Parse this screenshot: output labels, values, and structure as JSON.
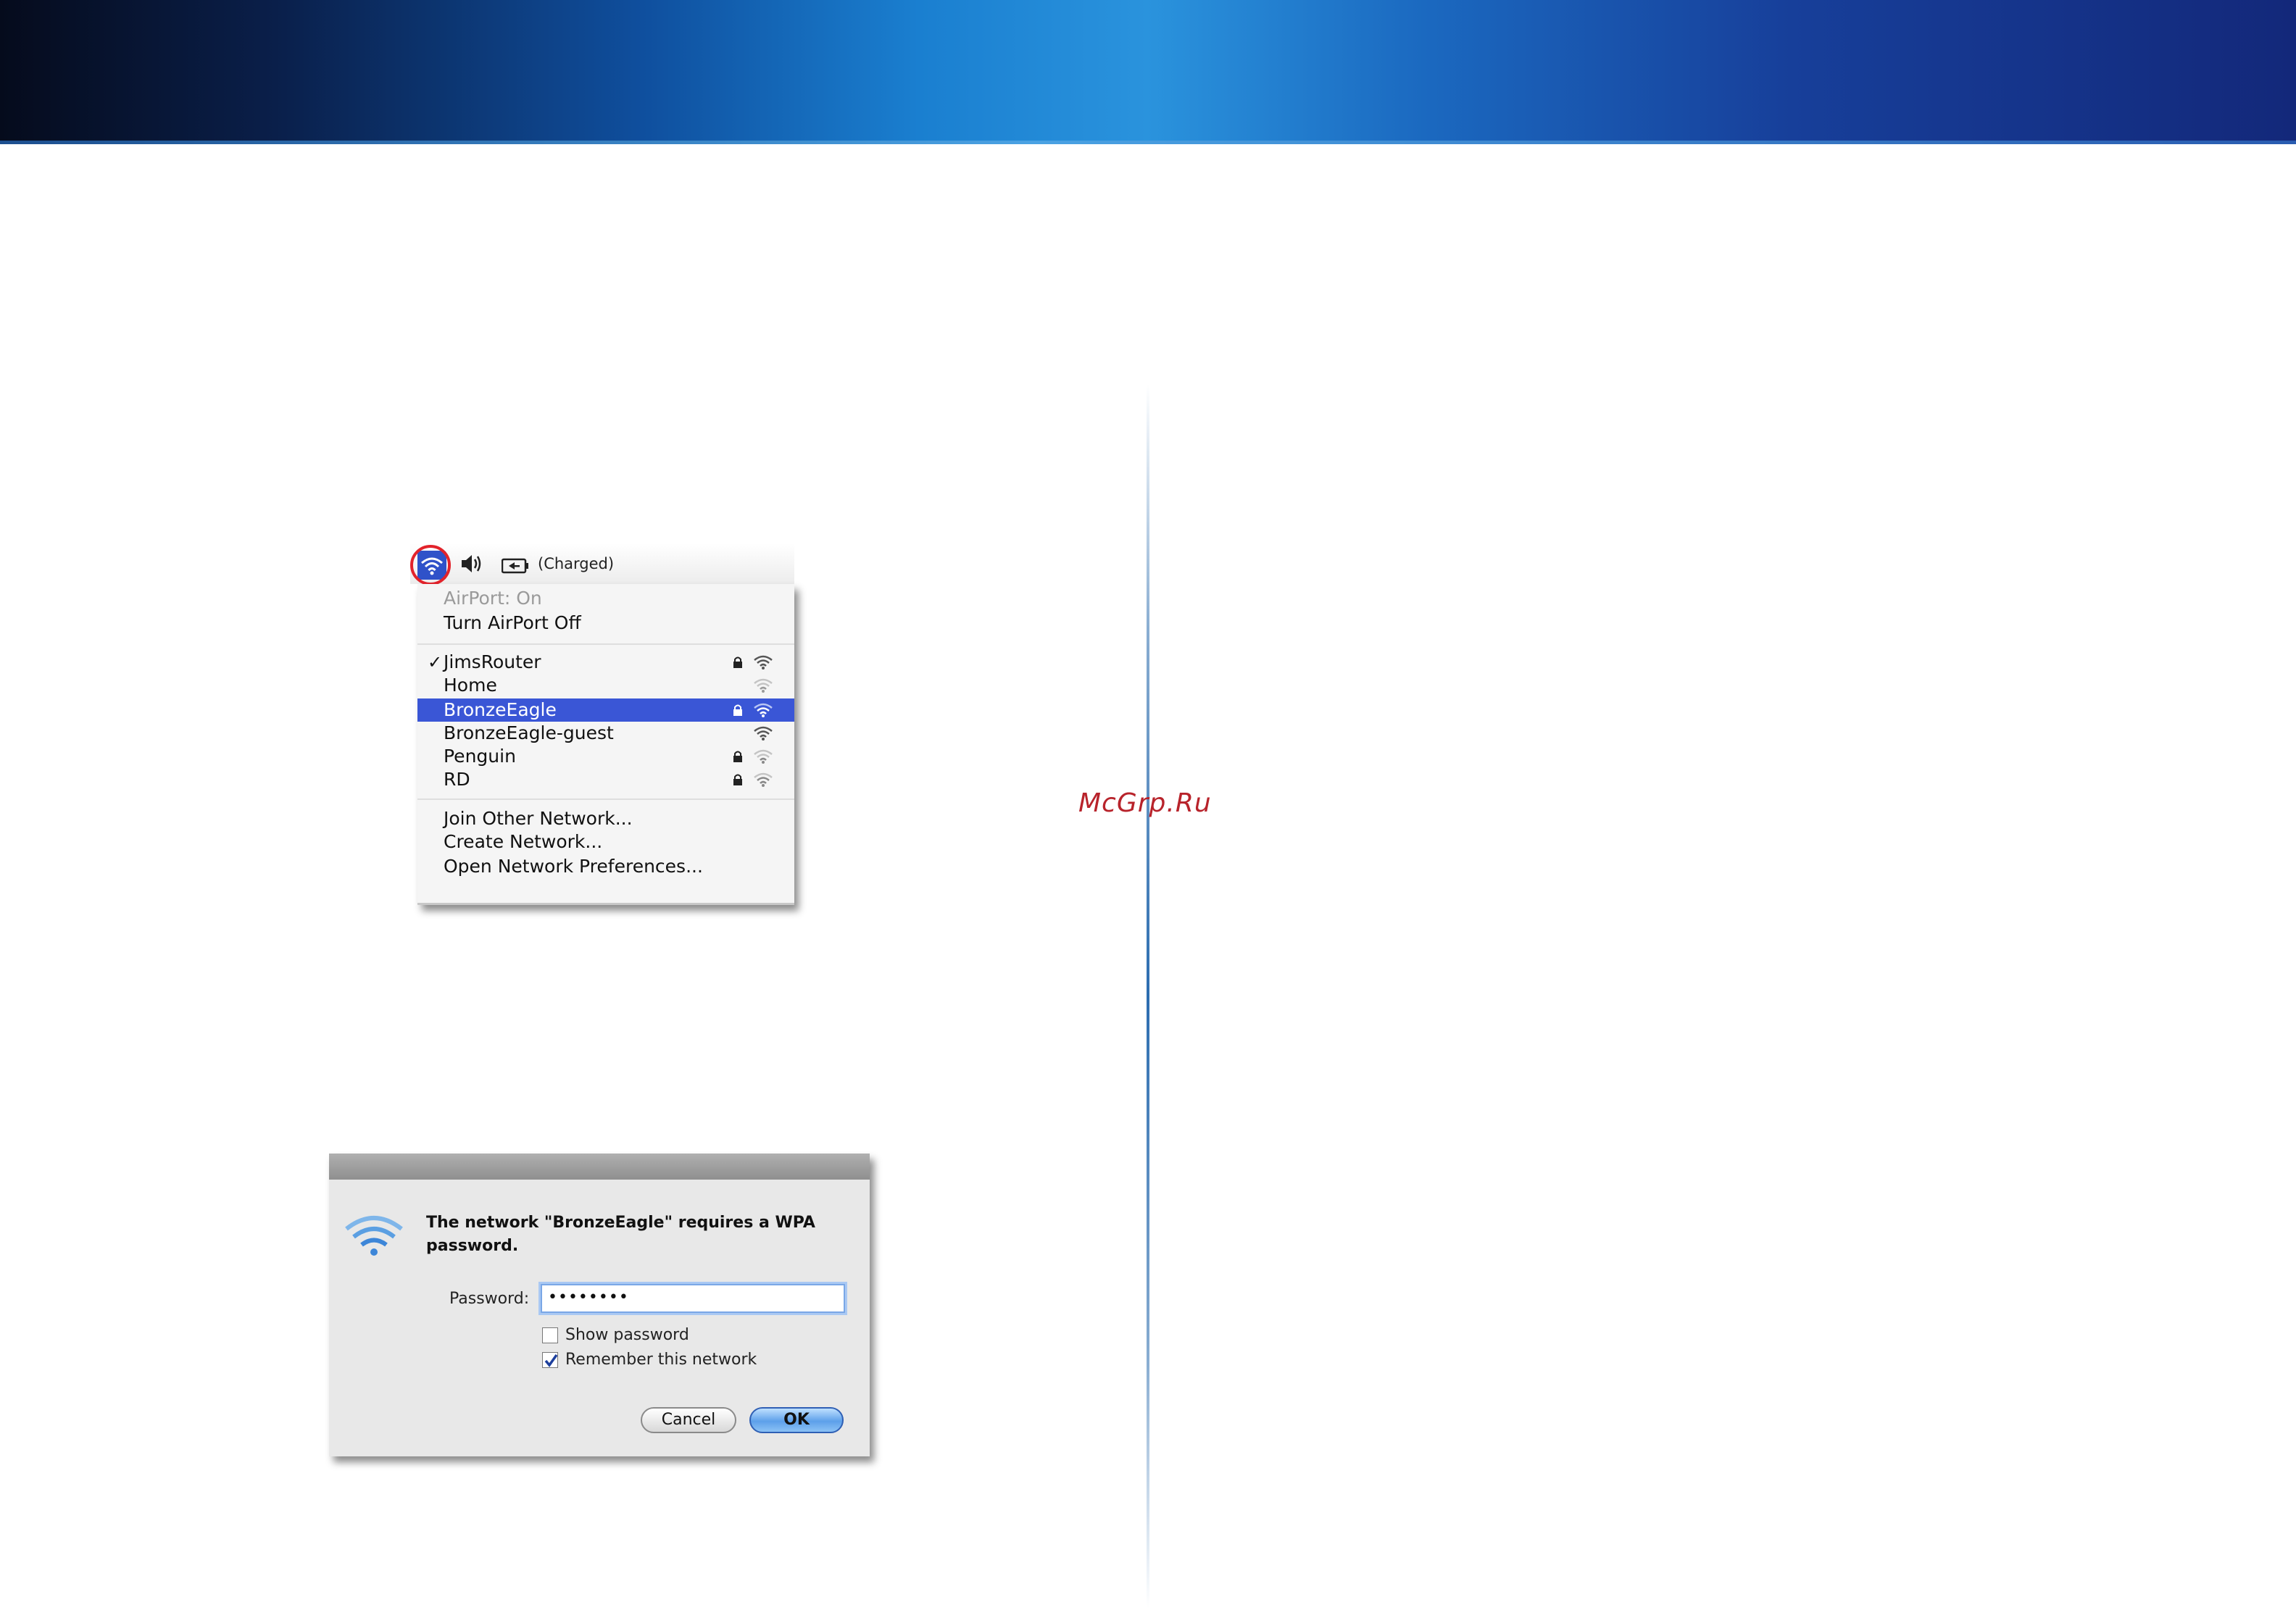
{
  "watermark": "McGrp.Ru",
  "menubar": {
    "battery_label": "(Charged)"
  },
  "menu": {
    "airport_status": "AirPort: On",
    "toggle": "Turn AirPort Off",
    "networks": [
      {
        "name": "JimsRouter",
        "checked": true,
        "locked": true,
        "selected": false
      },
      {
        "name": "Home",
        "checked": false,
        "locked": false,
        "selected": false
      },
      {
        "name": "BronzeEagle",
        "checked": false,
        "locked": true,
        "selected": true
      },
      {
        "name": "BronzeEagle-guest",
        "checked": false,
        "locked": false,
        "selected": false
      },
      {
        "name": "Penguin",
        "checked": false,
        "locked": true,
        "selected": false
      },
      {
        "name": "RD",
        "checked": false,
        "locked": true,
        "selected": false
      }
    ],
    "check_mark": "✓",
    "actions": {
      "join_other": "Join Other Network...",
      "create": "Create Network...",
      "preferences": "Open Network Preferences..."
    }
  },
  "dialog": {
    "message": "The network \"BronzeEagle\" requires a WPA password.",
    "password_label": "Password:",
    "password_value": "••••••••",
    "show_password": "Show password",
    "show_password_checked": false,
    "remember": "Remember this network",
    "remember_checked": true,
    "cancel": "Cancel",
    "ok": "OK"
  },
  "colors": {
    "selection": "#3a56d6",
    "highlight_ring": "#e2232b",
    "watermark": "#b8232b"
  }
}
